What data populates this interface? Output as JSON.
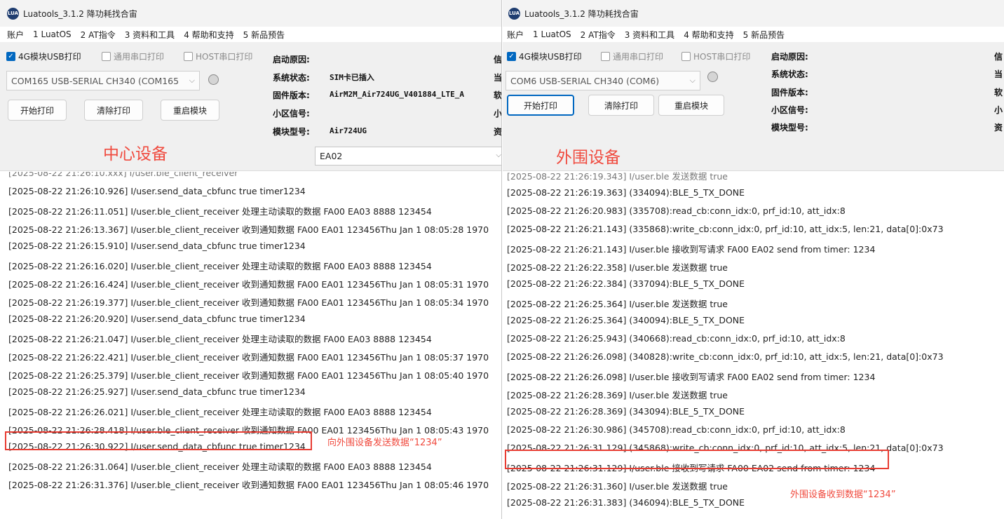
{
  "left": {
    "title": "Luatools_3.1.2 降功耗找合宙",
    "menu": [
      "账户",
      "1 LuatOS",
      "2 AT指令",
      "3 资料和工具",
      "4 帮助和支持",
      "5 新品预告"
    ],
    "checks": [
      "4G模块USB打印",
      "通用串口打印",
      "HOST串口打印"
    ],
    "port": "COM165 USB-SERIAL CH340 (COM165",
    "buttons": [
      "开始打印",
      "清除打印",
      "重启模块"
    ],
    "info_labels": [
      "启动原因:",
      "系统状态:",
      "固件版本:",
      "小区信号:",
      "模块型号:"
    ],
    "info_values": {
      "status": "SIM卡已插入",
      "firmware": "AirM2M_Air724UG_V401884_LTE_A",
      "model": "Air724UG"
    },
    "edge_chars": [
      "信",
      "当",
      "软",
      "小",
      "资"
    ],
    "label": "中心设备",
    "search_value": "EA02",
    "log_top_fragment": "[2025-08-22 21:26:10.xxx] I/user.ble_client_receiver",
    "log": [
      "[2025-08-22 21:26:10.926] I/user.send_data_cbfunc true timer1234",
      "[2025-08-22 21:26:11.051] I/user.ble_client_receiver 处理主动读取的数据 FA00 EA03 8888 123454",
      "[2025-08-22 21:26:13.367] I/user.ble_client_receiver 收到通知数据 FA00 EA01 123456Thu Jan  1 08:05:28 1970",
      "[2025-08-22 21:26:15.910] I/user.send_data_cbfunc true timer1234",
      "[2025-08-22 21:26:16.020] I/user.ble_client_receiver 处理主动读取的数据 FA00 EA03 8888 123454",
      "[2025-08-22 21:26:16.424] I/user.ble_client_receiver 收到通知数据 FA00 EA01 123456Thu Jan  1 08:05:31 1970",
      "[2025-08-22 21:26:19.377] I/user.ble_client_receiver 收到通知数据 FA00 EA01 123456Thu Jan  1 08:05:34 1970",
      "[2025-08-22 21:26:20.920] I/user.send_data_cbfunc true timer1234",
      "[2025-08-22 21:26:21.047] I/user.ble_client_receiver 处理主动读取的数据 FA00 EA03 8888 123454",
      "[2025-08-22 21:26:22.421] I/user.ble_client_receiver 收到通知数据 FA00 EA01 123456Thu Jan  1 08:05:37 1970",
      "[2025-08-22 21:26:25.379] I/user.ble_client_receiver 收到通知数据 FA00 EA01 123456Thu Jan  1 08:05:40 1970",
      "[2025-08-22 21:26:25.927] I/user.send_data_cbfunc true timer1234",
      "[2025-08-22 21:26:26.021] I/user.ble_client_receiver 处理主动读取的数据 FA00 EA03 8888 123454",
      "[2025-08-22 21:26:28.418] I/user.ble_client_receiver 收到通知数据 FA00 EA01 123456Thu Jan  1 08:05:43 1970",
      "[2025-08-22 21:26:30.922] I/user.send_data_cbfunc true timer1234",
      "[2025-08-22 21:26:31.064] I/user.ble_client_receiver 处理主动读取的数据 FA00 EA03 8888 123454",
      "[2025-08-22 21:26:31.376] I/user.ble_client_receiver 收到通知数据 FA00 EA01 123456Thu Jan  1 08:05:46 1970"
    ],
    "annotation": "向外围设备发送数据“1234”"
  },
  "right": {
    "title": "Luatools_3.1.2 降功耗找合宙",
    "menu": [
      "账户",
      "1 LuatOS",
      "2 AT指令",
      "3 资料和工具",
      "4 帮助和支持",
      "5 新品预告"
    ],
    "checks": [
      "4G模块USB打印",
      "通用串口打印",
      "HOST串口打印"
    ],
    "port": "COM6 USB-SERIAL CH340 (COM6)",
    "buttons": [
      "开始打印",
      "清除打印",
      "重启模块"
    ],
    "info_labels": [
      "启动原因:",
      "系统状态:",
      "固件版本:",
      "小区信号:",
      "模块型号:"
    ],
    "edge_chars": [
      "信",
      "当",
      "软",
      "小",
      "资"
    ],
    "label": "外围设备",
    "log_top_fragment": "[2025-08-22 21:26:19.343] I/user.ble 发送数据 true",
    "log": [
      "[2025-08-22 21:26:19.363] (334094):BLE_5_TX_DONE",
      "[2025-08-22 21:26:20.983] (335708):read_cb:conn_idx:0, prf_id:10, att_idx:8",
      "[2025-08-22 21:26:21.143] (335868):write_cb:conn_idx:0, prf_id:10, att_idx:5, len:21, data[0]:0x73",
      "[2025-08-22 21:26:21.143] I/user.ble 接收到写请求 FA00 EA02 send from timer: 1234",
      "[2025-08-22 21:26:22.358] I/user.ble 发送数据 true",
      "[2025-08-22 21:26:22.384] (337094):BLE_5_TX_DONE",
      "[2025-08-22 21:26:25.364] I/user.ble 发送数据 true",
      "[2025-08-22 21:26:25.364] (340094):BLE_5_TX_DONE",
      "[2025-08-22 21:26:25.943] (340668):read_cb:conn_idx:0, prf_id:10, att_idx:8",
      "[2025-08-22 21:26:26.098] (340828):write_cb:conn_idx:0, prf_id:10, att_idx:5, len:21, data[0]:0x73",
      "[2025-08-22 21:26:26.098] I/user.ble 接收到写请求 FA00 EA02 send from timer: 1234",
      "[2025-08-22 21:26:28.369] I/user.ble 发送数据 true",
      "[2025-08-22 21:26:28.369] (343094):BLE_5_TX_DONE",
      "[2025-08-22 21:26:30.986] (345708):read_cb:conn_idx:0, prf_id:10, att_idx:8",
      "[2025-08-22 21:26:31.129] (345868):write_cb:conn_idx:0, prf_id:10, att_idx:5, len:21, data[0]:0x73",
      "[2025-08-22 21:26:31.129] I/user.ble 接收到写请求 FA00 EA02 send from timer: 1234",
      "[2025-08-22 21:26:31.360] I/user.ble 发送数据 true",
      "[2025-08-22 21:26:31.383] (346094):BLE_5_TX_DONE"
    ],
    "annotation": "外围设备收到数据“1234”"
  },
  "colors": {
    "accent": "#0067c0",
    "annotation": "#f04a3e",
    "highlight": "#e83c32"
  }
}
